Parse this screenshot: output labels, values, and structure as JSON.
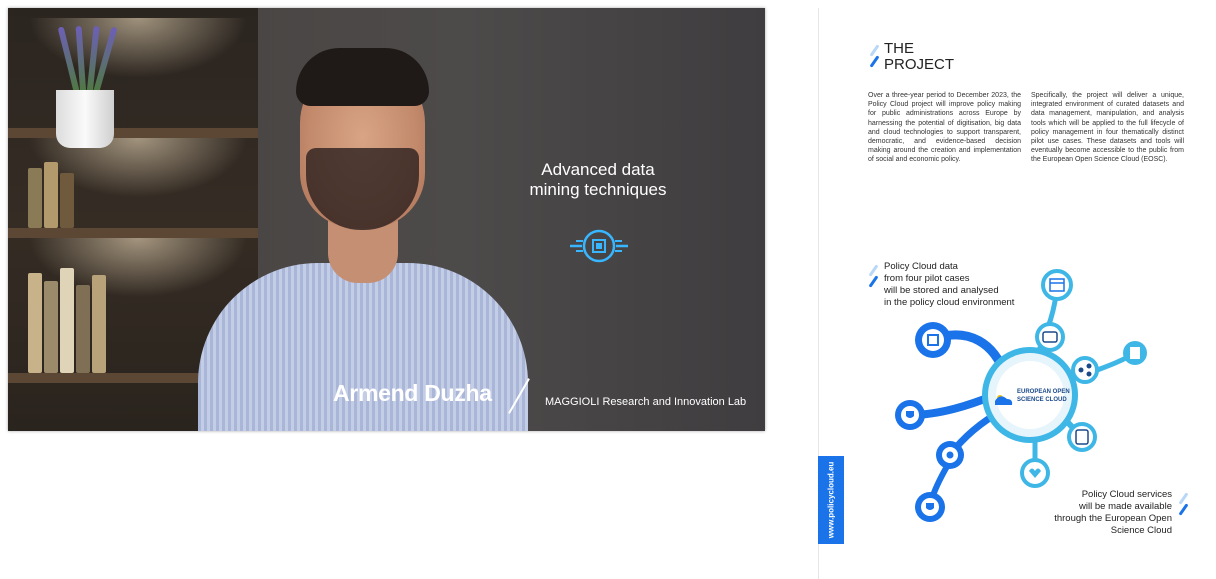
{
  "video": {
    "overlay_title": "Advanced data mining techniques",
    "overlay_icon": "data-chip-icon",
    "speaker_name": "Armend Duzha",
    "speaker_org": "MAGGIOLI Research and Innovation Lab"
  },
  "page": {
    "title_line1": "THE",
    "title_line2": "PROJECT",
    "paragraph_left": "Over a three-year period to December 2023, the Policy Cloud project will improve policy making for public administrations across Europe by harnessing the potential of digitisation, big data and cloud technologies to support transparent, democratic, and evidence-based decision making around the creation and implementation of social and economic policy.",
    "paragraph_right": "Specifically, the project will deliver a unique, integrated environment of curated datasets and data management, manipulation, and analysis tools which will be applied to the full lifecycle of policy management in four thematically distinct pilot use cases. These datasets and tools will eventually become accessible to the public from the European Open Science Cloud (EOSC).",
    "caption_top": [
      "Policy Cloud data",
      "from four pilot cases",
      "will be stored and analysed",
      "in the policy cloud environment"
    ],
    "caption_bottom": [
      "Policy Cloud services",
      "will be made available",
      "through the European Open",
      "Science Cloud"
    ],
    "side_tab": "www.policycloud.eu",
    "hub_label_line1": "EUROPEAN OPEN",
    "hub_label_line2": "SCIENCE CLOUD"
  },
  "colors": {
    "accent_blue": "#1a73e8",
    "light_blue": "#3fb7e6",
    "pale_blue": "#b9d7f7"
  }
}
